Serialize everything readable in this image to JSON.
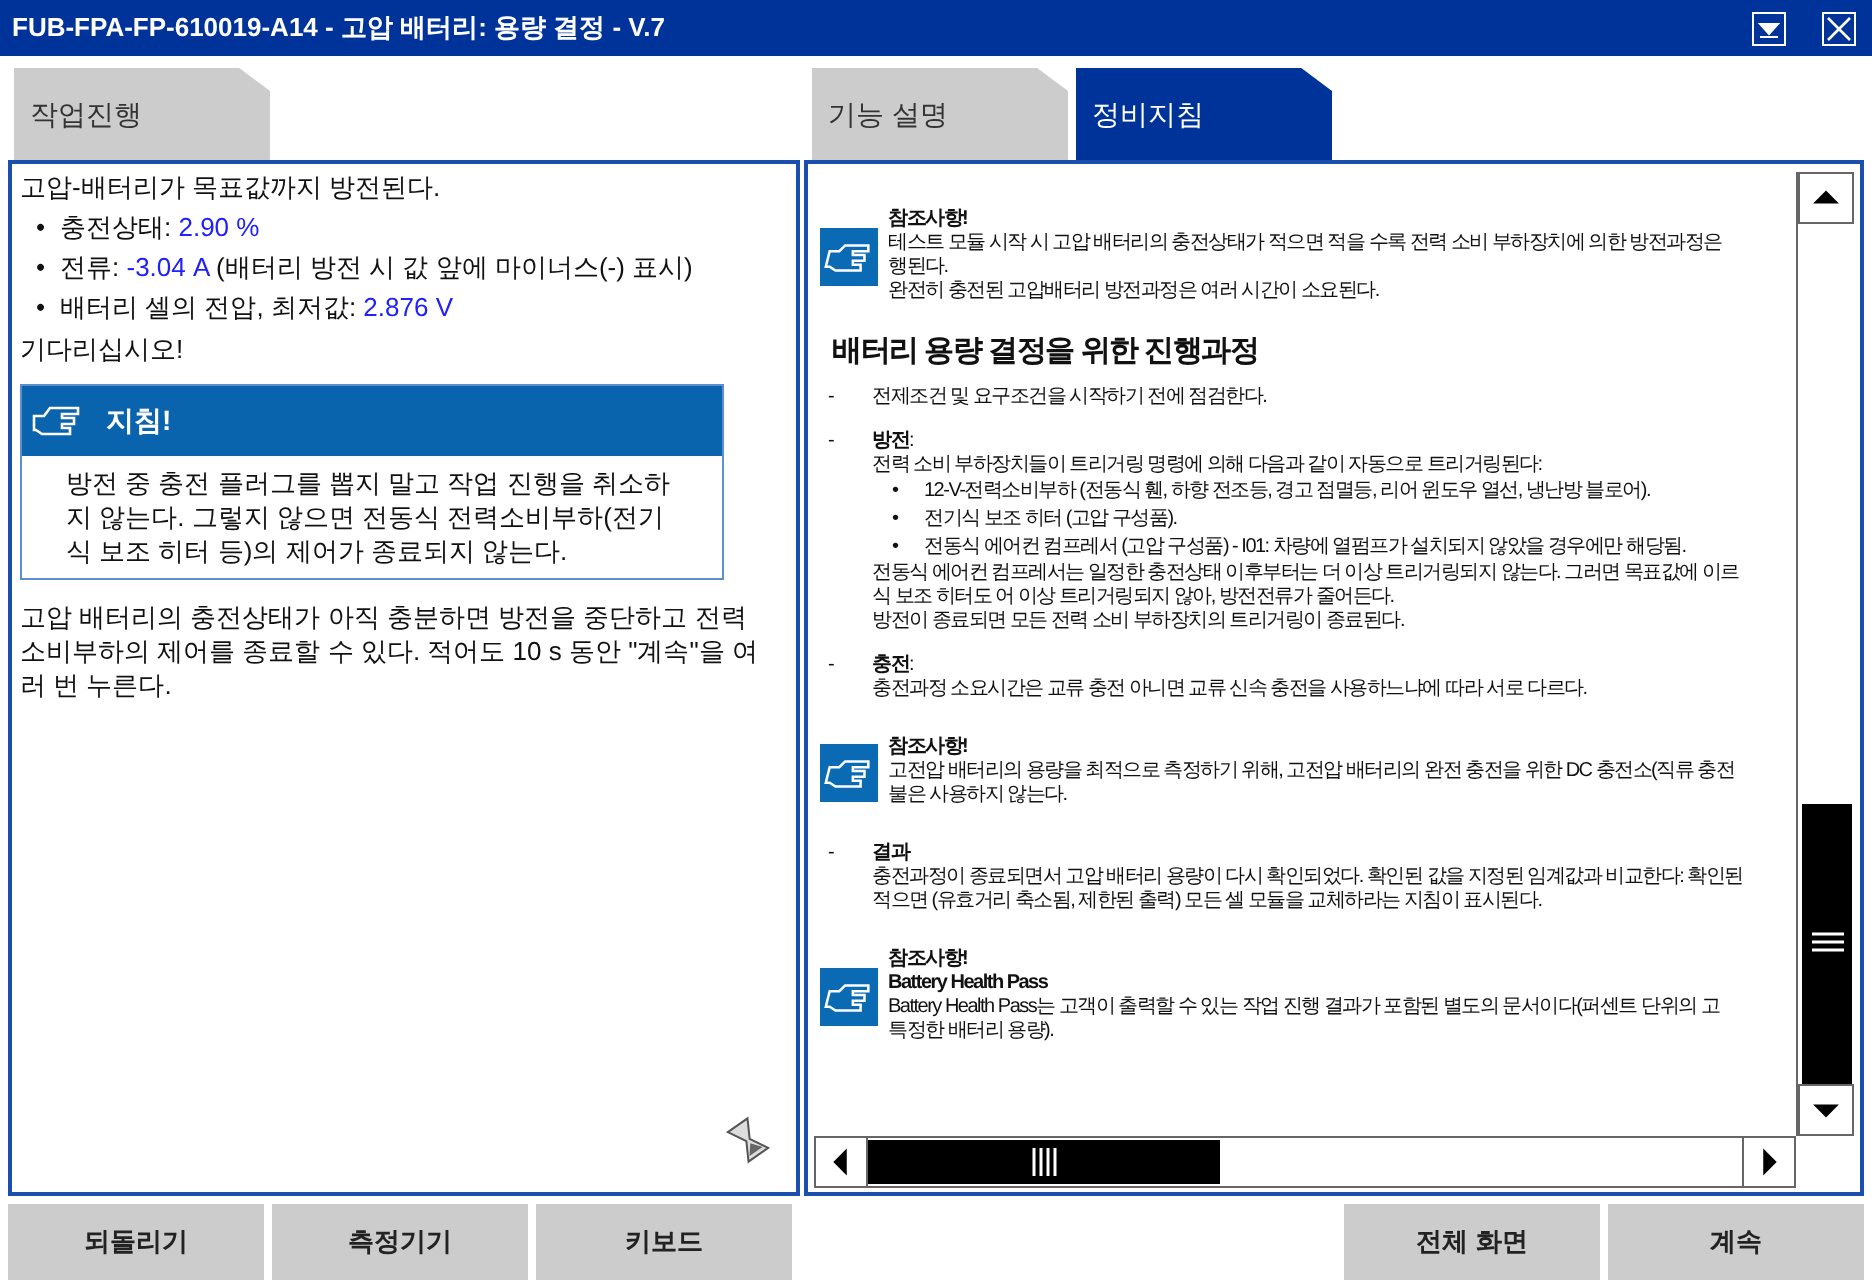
{
  "window": {
    "title": "FUB-FPA-FP-610019-A14 - 고압 배터리: 용량 결정 - V.7"
  },
  "left_tabs": [
    {
      "label": "작업진행",
      "selected": false
    }
  ],
  "right_tabs": [
    {
      "label": "기능 설명",
      "selected": false
    },
    {
      "label": "정비지침",
      "selected": true
    }
  ],
  "left_panel": {
    "intro": "고압-배터리가 목표값까지 방전된다.",
    "readings": [
      {
        "marker": "•",
        "label": "충전상태: ",
        "value": "2.90 %"
      },
      {
        "marker": "•",
        "label": "전류: ",
        "value": "-3.04 A",
        "note": " (배터리 방전 시 값 앞에 마이너스(-) 표시)"
      },
      {
        "marker": "•",
        "label": "배터리 셀의 전압, 최저값: ",
        "value": "2.876 V"
      }
    ],
    "wait_text": "기다리십시오!",
    "instruction": {
      "title": "지침!",
      "text": "방전 중 충전 플러그를 뽑지 말고 작업 진행을 취소하지 않는다. 그렇지 않으면 전동식 전력소비부하(전기식 보조 히터 등)의 제어가 종료되지 않는다."
    },
    "footer_text": "고압 배터리의 충전상태가 아직 충분하면 방전을 중단하고 전력소비부하의 제어를 종료할 수 있다. 적어도 10 s 동안 \"계속\"을 여러 번 누른다."
  },
  "right_panel": {
    "blocks": [
      {
        "kind": "note",
        "title": "참조사항!",
        "lines": [
          "테스트 모듈 시작 시 고압 배터리의 충전상태가 적으면 적을 수록 전력 소비 부하장치에 의한 방전과정은",
          "행된다.",
          "완전히 충전된 고압배터리 방전과정은 여러 시간이 소요된다."
        ]
      },
      {
        "kind": "heading",
        "text": "배터리 용량 결정을 위한 진행과정"
      },
      {
        "kind": "item",
        "marker": "-",
        "lines": [
          "전제조건 및 요구조건을 시작하기 전에 점검한다."
        ]
      },
      {
        "kind": "item",
        "marker": "-",
        "title": "**방전**:",
        "lines": [
          "전력 소비 부하장치들이 트리거링 명령에 의해 다음과 같이 자동으로 트리거링된다:"
        ],
        "bullets": [
          {
            "marker": "•",
            "text": "12-V-전력소비부하 (전동식 휀, 하향 전조등, 경고 점멸등, 리어 윈도우 열선, 냉난방 블로어)."
          },
          {
            "marker": "•",
            "text": "전기식 보조 히터 (고압 구성품)."
          },
          {
            "marker": "•",
            "text": "전동식 에어컨 컴프레서 (고압 구성품) - I01: 차량에 열펌프가 설치되지 않았을 경우에만 해당됨."
          }
        ],
        "after_lines": [
          "전동식 에어컨 컴프레서는 일정한 충전상태 이후부터는 더 이상 트리거링되지 않는다. 그러면 목표값에 이르",
          "식 보조 히터도 어 이상 트리거링되지 않아, 방전전류가 줄어든다.",
          "방전이 종료되면 모든 전력 소비 부하장치의 트리거링이 종료된다."
        ]
      },
      {
        "kind": "item",
        "marker": "-",
        "title": "**충전**:",
        "lines": [
          "충전과정 소요시간은 교류 충전 아니면 교류 신속 충전을 사용하느냐에 따라 서로 다르다."
        ]
      },
      {
        "kind": "note",
        "title": "참조사항!",
        "lines": [
          "고전압 배터리의 용량을 최적으로 측정하기 위해, 고전압 배터리의 완전 충전을 위한 DC 충전소(직류 충전",
          "불은 사용하지 않는다."
        ]
      },
      {
        "kind": "item",
        "marker": "-",
        "title": "**결과**",
        "lines": [
          "충전과정이 종료되면서 고압 배터리 용량이 다시 확인되었다. 확인된 값을 지정된 임계값과 비교한다: 확인된",
          "적으면 (유효거리 축소됨, 제한된 출력) 모든 셀 모듈을 교체하라는 지침이 표시된다."
        ]
      },
      {
        "kind": "note",
        "title": "참조사항!",
        "subtitle": "Battery Health Pass",
        "lines": [
          "Battery Health Pass는 고객이 출력할 수 있는 작업 진행 결과가 포함된 별도의 문서이다(퍼센트 단위의 고",
          "특정한 배터리 용량)."
        ]
      }
    ]
  },
  "bottom_buttons_left": [
    "되돌리기",
    "측정기기",
    "키보드"
  ],
  "bottom_buttons_right": [
    "전체 화면",
    "계속"
  ]
}
